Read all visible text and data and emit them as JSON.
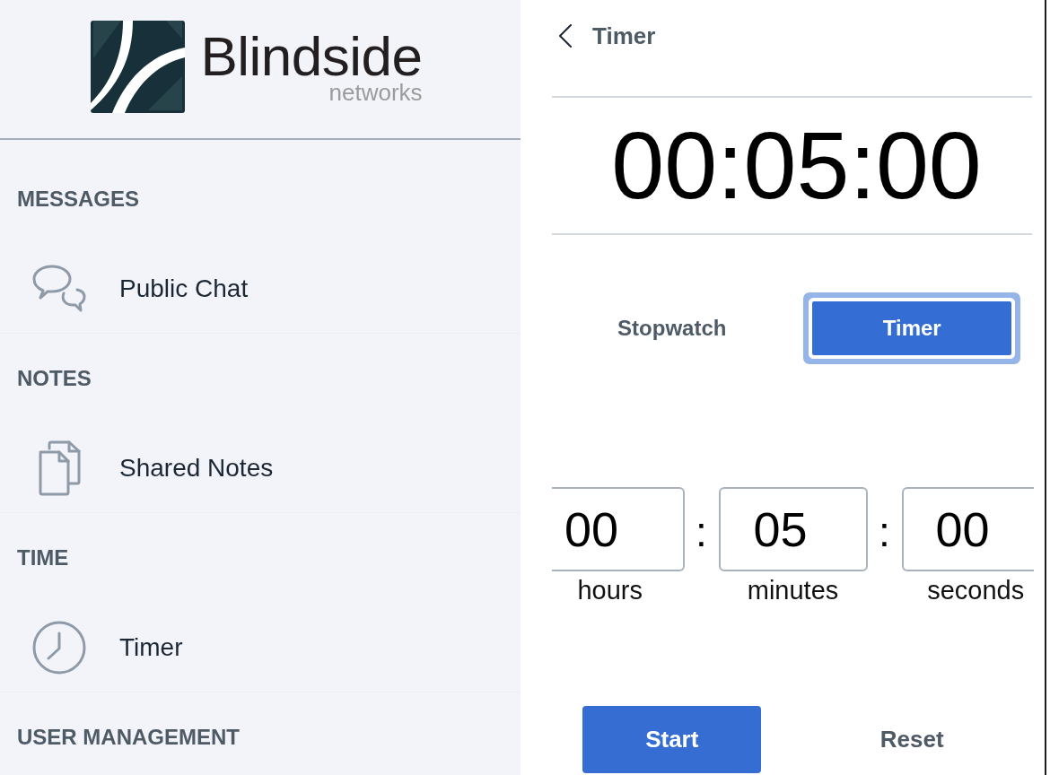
{
  "sidebar": {
    "logo": {
      "name": "Blindside",
      "tagline": "networks"
    },
    "sections": [
      {
        "title": "MESSAGES",
        "items": [
          {
            "label": "Public Chat",
            "kind": "chat",
            "selected": false
          }
        ]
      },
      {
        "title": "NOTES",
        "items": [
          {
            "label": "Shared Notes",
            "kind": "notes",
            "selected": false
          }
        ]
      },
      {
        "title": "TIME",
        "items": [
          {
            "label": "Timer",
            "kind": "clock",
            "selected": false
          }
        ]
      },
      {
        "title": "USER MANAGEMENT"
      }
    ]
  },
  "panel": {
    "title": "Timer",
    "display": "00:05:00",
    "modes": [
      {
        "label": "Stopwatch",
        "selected": false,
        "focused": false
      },
      {
        "label": "Timer",
        "selected": true,
        "focused": true
      }
    ],
    "fields": [
      {
        "value": "00",
        "label": "hours",
        "separator": ":"
      },
      {
        "value": "05",
        "label": "minutes",
        "separator": ":"
      },
      {
        "value": "00",
        "label": "seconds"
      }
    ],
    "actions": [
      {
        "label": "Start",
        "kind": "primary"
      },
      {
        "label": "Reset",
        "kind": "plain"
      }
    ]
  }
}
